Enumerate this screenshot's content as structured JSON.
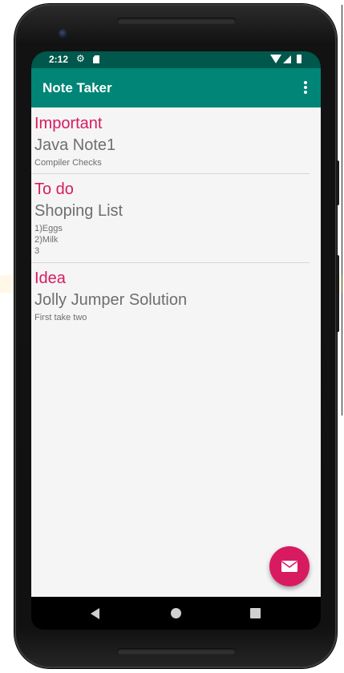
{
  "status_bar": {
    "time": "2:12",
    "icons": [
      "gear-icon",
      "sd-card-icon",
      "wifi-icon",
      "signal-icon",
      "battery-icon"
    ]
  },
  "app_bar": {
    "title": "Note Taker",
    "overflow_icon": "more-vert-icon"
  },
  "notes": [
    {
      "category": "Important",
      "title": "Java Note1",
      "body": "Compiler Checks"
    },
    {
      "category": "To do",
      "title": "Shoping List",
      "body": "1)Eggs\n2)Milk\n3"
    },
    {
      "category": "Idea",
      "title": "Jolly Jumper Solution",
      "body": "First take two"
    }
  ],
  "fab": {
    "icon": "email-icon"
  },
  "nav_bar": {
    "icons": [
      "back-icon",
      "home-icon",
      "recents-icon"
    ]
  },
  "colors": {
    "primary": "#008577",
    "primary_dark": "#00574b",
    "accent": "#d81b60",
    "text_secondary": "#6e6e6e",
    "background": "#f5f5f5"
  }
}
